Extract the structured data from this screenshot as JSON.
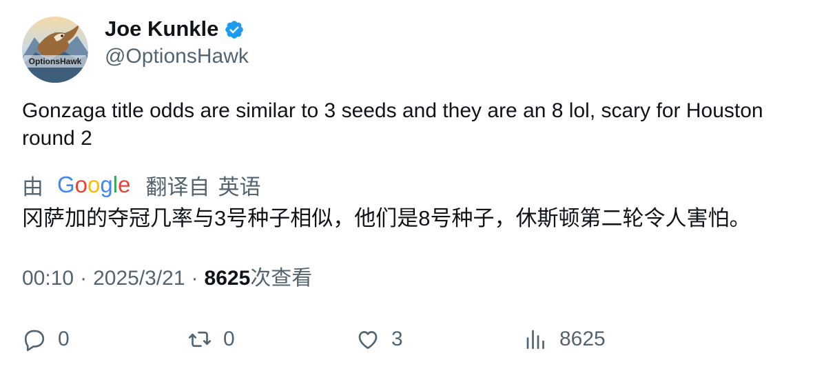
{
  "author": {
    "name": "Joe Kunkle",
    "handle": "@OptionsHawk",
    "avatar_logo_text": "OptionsHawk",
    "verified": true,
    "verified_color": "#1d9bf0"
  },
  "tweet": {
    "text": "Gonzaga title odds are similar to 3 seeds and they are an 8 lol, scary for Houston round 2"
  },
  "translation": {
    "prefix": "由",
    "provider": "Google",
    "provider_letters": [
      {
        "ch": "G",
        "color": "#4285F4"
      },
      {
        "ch": "o",
        "color": "#EA4335"
      },
      {
        "ch": "o",
        "color": "#FBBC05"
      },
      {
        "ch": "g",
        "color": "#4285F4"
      },
      {
        "ch": "l",
        "color": "#34A853"
      },
      {
        "ch": "e",
        "color": "#EA4335"
      }
    ],
    "suffix": "翻译自",
    "source_language": "英语",
    "translated_text": "冈萨加的夺冠几率与3号种子相似，他们是8号种子，休斯顿第二轮令人害怕。"
  },
  "meta": {
    "time": "00:10",
    "separator": "·",
    "date": "2025/3/21",
    "views_count": "8625",
    "views_label": "次查看"
  },
  "actions": {
    "reply_count": "0",
    "retweet_count": "0",
    "like_count": "3",
    "views_count": "8625",
    "icon_color": "#536471"
  }
}
